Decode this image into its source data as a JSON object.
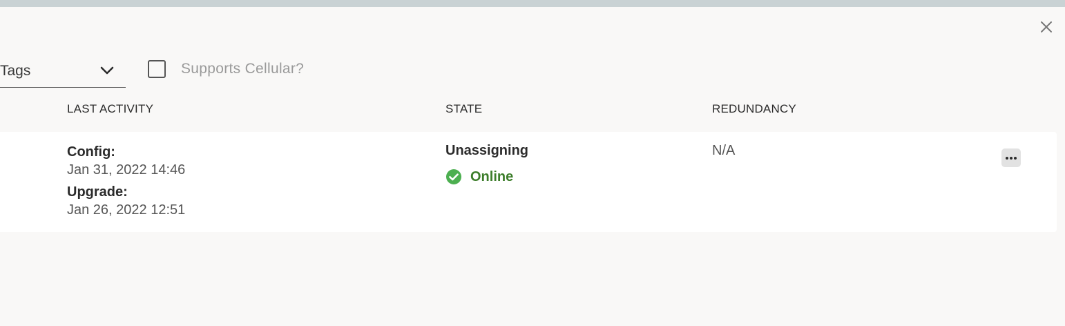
{
  "colors": {
    "top_strip": "#c9d2d4",
    "background": "#f9f8f7",
    "online": "#3c7d2a",
    "online_icon": "#4caf50"
  },
  "filters": {
    "tags_label": "Tags",
    "cellular_label": "Supports Cellular?",
    "cellular_checked": false
  },
  "table": {
    "headers": {
      "last_activity": "LAST ACTIVITY",
      "state": "STATE",
      "redundancy": "REDUNDANCY"
    },
    "row": {
      "config_label": "Config:",
      "config_value": "Jan 31, 2022 14:46",
      "upgrade_label": "Upgrade:",
      "upgrade_value": "Jan 26, 2022 12:51",
      "state": "Unassigning",
      "status": "Online",
      "redundancy": "N/A"
    }
  },
  "icons": {
    "close": "close-icon",
    "chevron": "chevron-down-icon",
    "status": "check-circle-icon",
    "more": "more-horizontal-icon"
  }
}
